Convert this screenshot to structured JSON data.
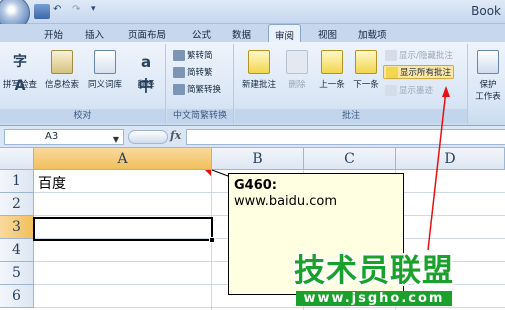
{
  "window": {
    "title": "Book"
  },
  "tabs": [
    "开始",
    "插入",
    "页面布局",
    "公式",
    "数据",
    "审阅",
    "视图",
    "加载项"
  ],
  "active_tab": "审阅",
  "ribbon": {
    "proofing": {
      "label": "校对",
      "buttons": [
        "拼写检查",
        "信息检索",
        "同义词库",
        "翻译"
      ]
    },
    "chinese_conversion": {
      "label": "中文简繁转换",
      "buttons": [
        "繁转简",
        "简转繁",
        "简繁转换"
      ]
    },
    "comments": {
      "label": "批注",
      "buttons": [
        "新建批注",
        "删除",
        "上一条",
        "下一条"
      ],
      "toggles": [
        "显示/隐藏批注",
        "显示所有批注",
        "显示墨迹"
      ]
    },
    "protect": {
      "labels": [
        "保护",
        "工作表"
      ]
    }
  },
  "formula_bar": {
    "name_box": "A3",
    "fx_label": "fx",
    "formula": ""
  },
  "grid": {
    "columns": [
      "A",
      "B",
      "C",
      "D"
    ],
    "rows": [
      "1",
      "2",
      "3",
      "4",
      "5",
      "6"
    ],
    "cells": {
      "A1": "百度"
    },
    "selected_cell": "A3"
  },
  "comment": {
    "author": "G460:",
    "text": "www.baidu.com"
  },
  "watermark": {
    "main": "技术员联盟",
    "url": "www.jsgho.com"
  },
  "colors": {
    "accent": "#f1c05c",
    "ribbon": "#dae6f5",
    "comment_bg": "#ffffe1",
    "watermark": "#1aa12b",
    "arrow": "#e81010"
  }
}
